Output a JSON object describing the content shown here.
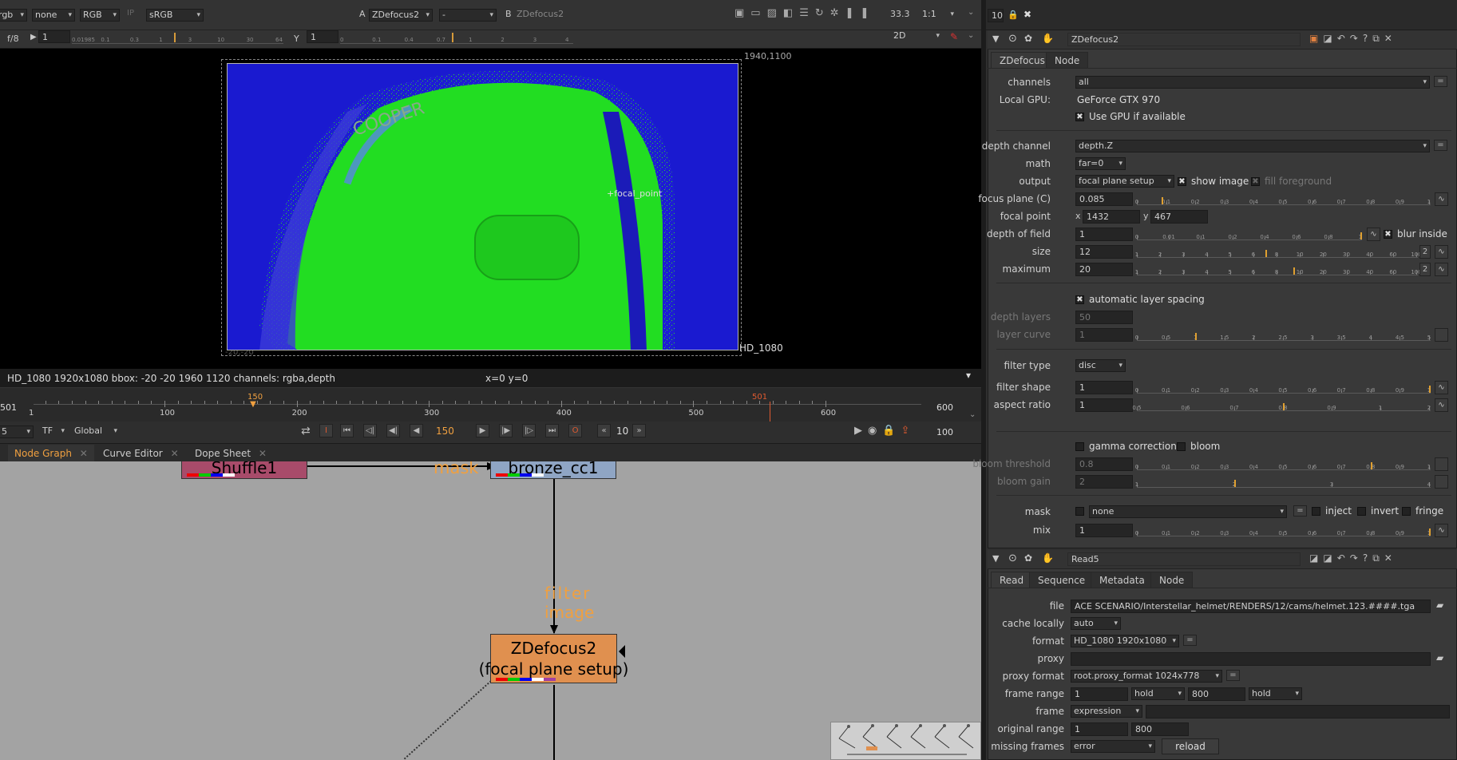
{
  "viewer_toolbar": {
    "channels_a": "rgb",
    "channels_b": "none",
    "layer": "RGB",
    "ip": "IP",
    "colorspace": "sRGB",
    "a_label": "A",
    "input_a": "ZDefocus2",
    "input_mid": "-",
    "b_label": "B",
    "input_b": "ZDefocus2",
    "zoom": "33.3",
    "ratio": "1:1",
    "fstop": "f/8",
    "gain": "1",
    "gamma_label": "Y",
    "gamma": "1",
    "view_mode": "2D",
    "gain_ticks": [
      "0.01985",
      "0.1",
      "0.3",
      "1",
      "3",
      "10",
      "30",
      "64"
    ],
    "gamma_ticks": [
      "0",
      "0.1",
      "0.4",
      "0.7",
      "1",
      "2",
      "3",
      "4"
    ]
  },
  "viewer": {
    "bbox_top_right": "1940,1100",
    "format_label": "HD_1080",
    "bbox_bottom_left": "-20,-20",
    "focal_point_label": "focal_point",
    "image_text": "COOPER",
    "info_bar": "HD_1080 1920x1080  bbox: -20 -20 1960 1120 channels: rgba,depth",
    "coords": "x=0 y=0"
  },
  "timeline": {
    "start_frame": "501",
    "end_frame": "600",
    "current_marker": "150",
    "end_marker": "501",
    "ticks": [
      "1",
      "100",
      "200",
      "300",
      "400",
      "500",
      "600"
    ],
    "fps": "5",
    "tf": "TF",
    "scope": "Global",
    "current_frame": "150",
    "step": "10",
    "end_value": "100"
  },
  "graph_tabs": [
    "Node Graph",
    "Curve Editor",
    "Dope Sheet"
  ],
  "node_graph": {
    "nodes": {
      "shuffle": "Shuffle1",
      "bronze": "bronze_cc1",
      "zdefocus_name": "ZDefocus2",
      "zdefocus_sub": "(focal plane setup)"
    },
    "labels": {
      "mask": "mask",
      "filter_line1": "filter",
      "filter_line2": "image"
    }
  },
  "zdefocus_panel": {
    "header_number": "10",
    "node_name": "ZDefocus2",
    "tabs": [
      "ZDefocus",
      "Node"
    ],
    "channels_label": "channels",
    "channels": "all",
    "local_gpu_label": "Local GPU:",
    "local_gpu": "GeForce GTX 970",
    "use_gpu": "Use GPU if available",
    "depth_channel_label": "depth channel",
    "depth_channel": "depth.Z",
    "math_label": "math",
    "math": "far=0",
    "output_label": "output",
    "output": "focal plane setup",
    "show_image": "show image",
    "fill_foreground": "fill foreground",
    "focus_plane_label": "focus plane (C)",
    "focus_plane": "0.085",
    "focal_point_label": "focal point",
    "fp_x_label": "x",
    "fp_x": "1432",
    "fp_y_label": "y",
    "fp_y": "467",
    "dof_label": "depth of field",
    "dof": "1",
    "blur_inside": "blur inside",
    "size_label": "size",
    "size": "12",
    "maximum_label": "maximum",
    "maximum": "20",
    "size_badge": "2",
    "max_badge": "2",
    "auto_layer": "automatic layer spacing",
    "depth_layers_label": "depth layers",
    "depth_layers": "50",
    "layer_curve_label": "layer curve",
    "layer_curve": "1",
    "filter_type_label": "filter type",
    "filter_type": "disc",
    "filter_shape_label": "filter shape",
    "filter_shape": "1",
    "aspect_ratio_label": "aspect ratio",
    "aspect_ratio": "1",
    "gamma_correction": "gamma correction",
    "bloom": "bloom",
    "bloom_threshold_label": "bloom threshold",
    "bloom_threshold": "0.8",
    "bloom_gain_label": "bloom gain",
    "bloom_gain": "2",
    "mask_label": "mask",
    "mask": "none",
    "inject": "inject",
    "invert": "invert",
    "fringe": "fringe",
    "mix_label": "mix",
    "mix": "1",
    "slider_ticks": {
      "unit": [
        "0",
        "0.1",
        "0.2",
        "0.3",
        "0.4",
        "0.5",
        "0.6",
        "0.7",
        "0.8",
        "0.9",
        "1"
      ],
      "dof": [
        "0",
        "0.01",
        "0.1",
        "0.2",
        "0.4",
        "0.6",
        "0.8",
        "1"
      ],
      "size": [
        "1",
        "2",
        "3",
        "4",
        "5",
        "6",
        "8",
        "10",
        "20",
        "30",
        "40",
        "60",
        "100"
      ],
      "layer_curve": [
        "0",
        "0.5",
        "1",
        "1.5",
        "2",
        "2.5",
        "3",
        "3.5",
        "4",
        "4.5",
        "5"
      ],
      "aspect": [
        "0.5",
        "0.6",
        "0.7",
        "0.8",
        "0.9",
        "1",
        "2"
      ],
      "bloom_gain": [
        "1",
        "2",
        "3",
        "4"
      ]
    }
  },
  "read_panel": {
    "node_name": "Read5",
    "tabs": [
      "Read",
      "Sequence",
      "Metadata",
      "Node"
    ],
    "file_label": "file",
    "file": "ACE SCENARIO/Interstellar_helmet/RENDERS/12/cams/helmet.123.####.tga",
    "cache_label": "cache locally",
    "cache": "auto",
    "format_label": "format",
    "format": "HD_1080 1920x1080",
    "proxy_label": "proxy",
    "proxy": "",
    "proxy_format_label": "proxy format",
    "proxy_format": "root.proxy_format 1024x778",
    "frame_range_label": "frame range",
    "frame_start": "1",
    "frame_start_mode": "hold",
    "frame_end": "800",
    "frame_end_mode": "hold",
    "frame_label": "frame",
    "frame_mode": "expression",
    "original_range_label": "original range",
    "orig_start": "1",
    "orig_end": "800",
    "missing_label": "missing frames",
    "missing": "error",
    "reload": "reload"
  },
  "colors": {
    "viewer_bg": "#000000",
    "image_blue": "#1a1ad0",
    "image_green": "#22dd22",
    "node_orange": "#e0904f",
    "node_bronze": "#8fa5c4",
    "node_shuffle": "#a84b6a",
    "graph_bg": "#a3a3a3",
    "accent_orange": "#f0a040"
  }
}
